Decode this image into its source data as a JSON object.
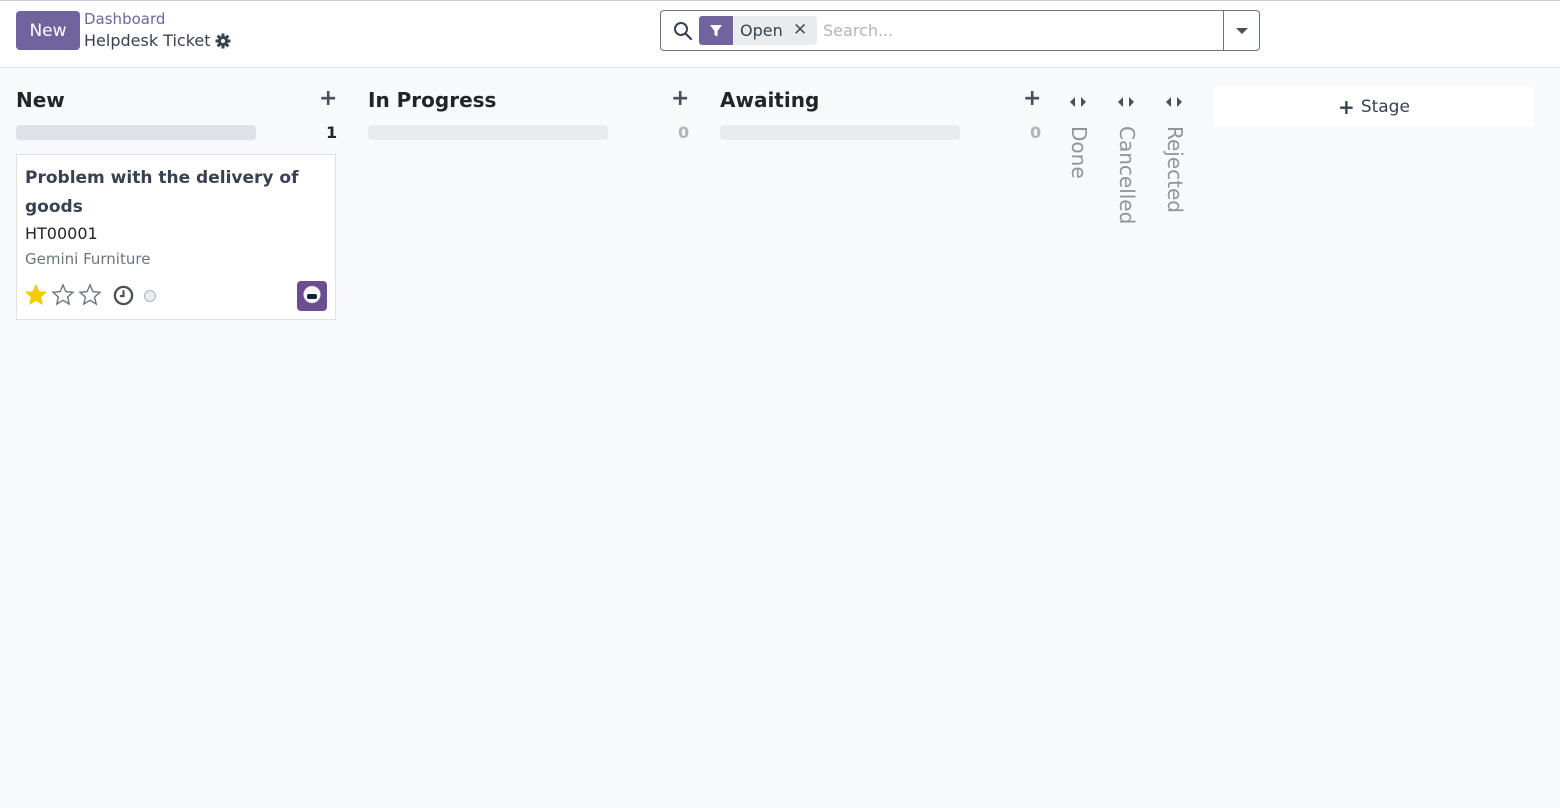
{
  "header": {
    "new_button": "New",
    "breadcrumb_parent": "Dashboard",
    "breadcrumb_current": "Helpdesk Ticket"
  },
  "search": {
    "facet_label": "Open",
    "facet_close": "✕",
    "placeholder": "Search..."
  },
  "columns": [
    {
      "title": "New",
      "add": "+",
      "count": "1"
    },
    {
      "title": "In Progress",
      "add": "+",
      "count": "0"
    },
    {
      "title": "Awaiting",
      "add": "+",
      "count": "0"
    }
  ],
  "card": {
    "title": "Problem with the delivery of goods",
    "reference": "HT00001",
    "customer": "Gemini Furniture",
    "rating": 1,
    "rating_max": 3
  },
  "folded_stages": [
    {
      "label": "Done"
    },
    {
      "label": "Cancelled"
    },
    {
      "label": "Rejected"
    }
  ],
  "add_stage": {
    "plus": "+",
    "label": "Stage"
  },
  "colors": {
    "brand": "#71639e",
    "star_filled": "#f3cc00",
    "background": "#f8f9fa"
  },
  "icons": [
    "gear-icon",
    "search-icon",
    "filter-icon",
    "close-icon",
    "caret-down-icon",
    "plus-icon",
    "star-icon",
    "clock-icon",
    "fold-arrows-icon"
  ]
}
